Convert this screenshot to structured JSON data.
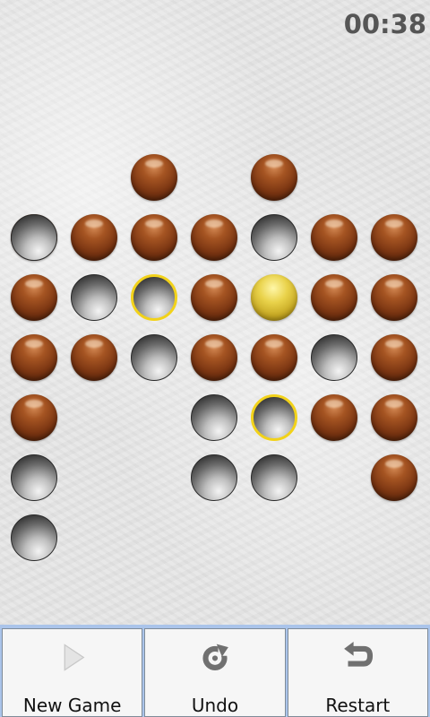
{
  "timer": "00:38",
  "board": {
    "balls": [
      [
        2,
        0
      ],
      [
        4,
        0
      ],
      [
        0,
        1
      ],
      [
        1,
        1
      ],
      [
        2,
        1
      ],
      [
        3,
        1
      ],
      [
        5,
        1
      ],
      [
        6,
        1
      ],
      [
        0,
        2
      ],
      [
        3,
        2
      ],
      [
        5,
        2
      ],
      [
        6,
        2
      ],
      [
        0,
        3
      ],
      [
        1,
        3
      ],
      [
        3,
        3
      ],
      [
        4,
        3
      ],
      [
        6,
        3
      ],
      [
        0,
        4
      ],
      [
        5,
        4
      ],
      [
        6,
        4
      ],
      [
        6,
        5
      ]
    ],
    "holes": [
      [
        0,
        1.0
      ],
      [
        4,
        1
      ],
      [
        1,
        2
      ],
      [
        2,
        2
      ],
      [
        2,
        3
      ],
      [
        5,
        3
      ],
      [
        3,
        4
      ],
      [
        4,
        4
      ],
      [
        0,
        5
      ],
      [
        3,
        5
      ],
      [
        4,
        5
      ],
      [
        0,
        6
      ]
    ],
    "selected": [
      [
        4,
        2
      ]
    ],
    "targets": [
      [
        2,
        2
      ],
      [
        4,
        4
      ]
    ]
  },
  "toolbar": {
    "new_game_label": "New Game",
    "undo_label": "Undo",
    "restart_label": "Restart"
  },
  "colors": {
    "ball": "#7a3512",
    "selected_ball": "#e9d24a",
    "target_ring": "#f2d21a",
    "toolbar_bg": "#aac4ea"
  }
}
